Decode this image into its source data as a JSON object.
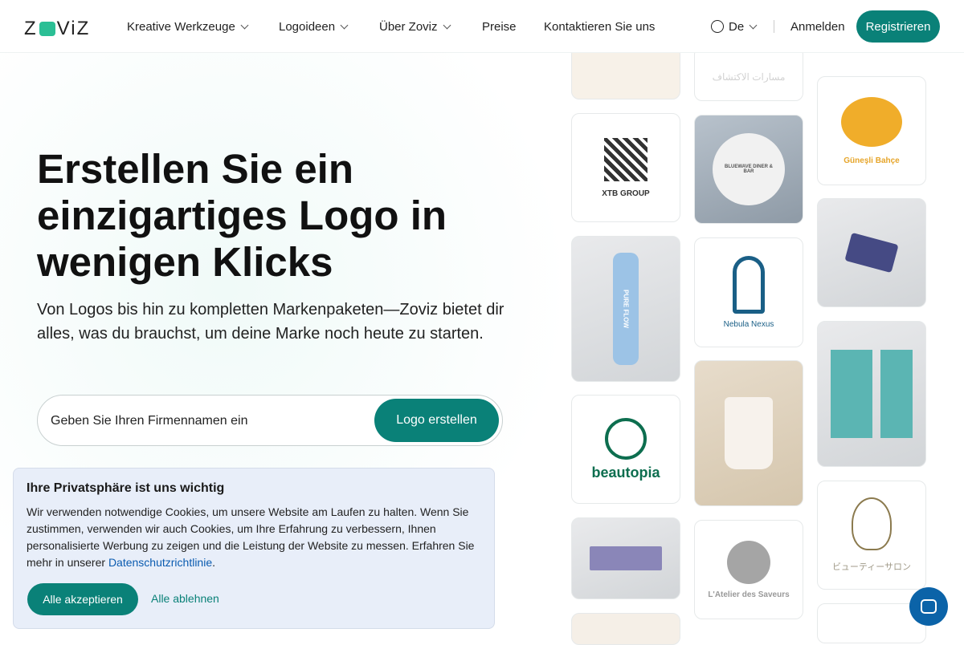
{
  "header": {
    "logo": "ZOVIZ",
    "nav": [
      {
        "label": "Kreative Werkzeuge",
        "dropdown": true
      },
      {
        "label": "Logoideen",
        "dropdown": true
      },
      {
        "label": "Über Zoviz",
        "dropdown": true
      },
      {
        "label": "Preise",
        "dropdown": false
      },
      {
        "label": "Kontaktieren Sie uns",
        "dropdown": false
      }
    ],
    "language": "De",
    "login": "Anmelden",
    "register": "Registrieren"
  },
  "hero": {
    "title": "Erstellen Sie ein einzigartiges Logo in wenigen Klicks",
    "subtitle": "Von Logos bis hin zu kompletten Markenpaketen—Zoviz bietet dir alles, was du brauchst, um deine Marke noch heute zu starten.",
    "search_placeholder": "Geben Sie Ihren Firmennamen ein",
    "search_value": "",
    "cta": "Logo erstellen"
  },
  "gallery": {
    "xtb": "XTB GROUP",
    "arabic": "مسارات الاكتشاف",
    "gunesli": "Güneşli Bahçe",
    "nebula": "Nebula Nexus",
    "beautopia": "beautopia",
    "atelier": "L'Atelier des Saveurs",
    "salon": "ビューティーサロン",
    "bluewave": "BLUEWAVE DINER & BAR",
    "pureflow": "PURE FLOW"
  },
  "cookie": {
    "title": "Ihre Privatsphäre ist uns wichtig",
    "text": "Wir verwenden notwendige Cookies, um unsere Website am Laufen zu halten. Wenn Sie zustimmen, verwenden wir auch Cookies, um Ihre Erfahrung zu verbessern, Ihnen personalisierte Werbung zu zeigen und die Leistung der Website zu messen. Erfahren Sie mehr in unserer ",
    "link": "Datenschutzrichtlinie",
    "end": ".",
    "accept": "Alle akzeptieren",
    "reject": "Alle ablehnen"
  },
  "colors": {
    "accent": "#0a8178",
    "chat": "#0b63a8",
    "cookie_bg": "#e8eef9"
  }
}
